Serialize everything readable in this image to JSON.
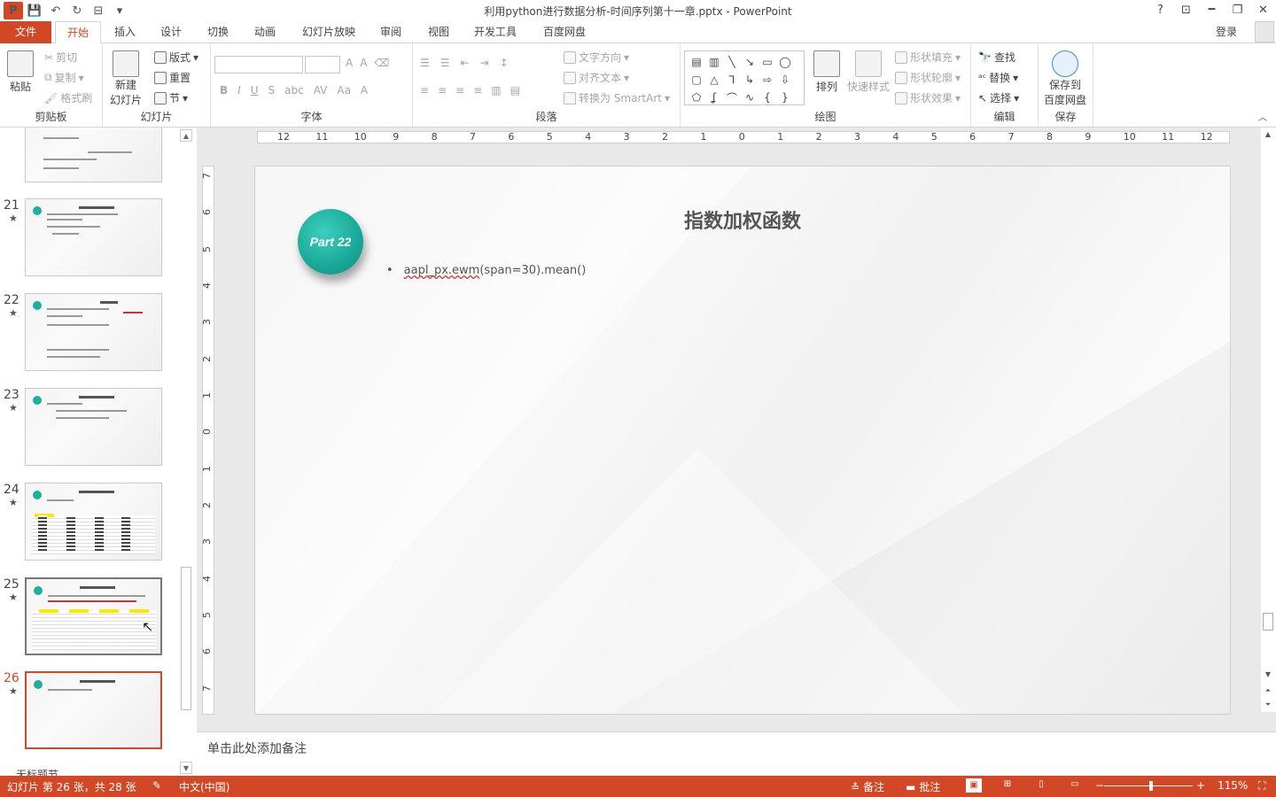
{
  "window": {
    "title": "利用python进行数据分析-时间序列第十一章.pptx - PowerPoint",
    "help": "?",
    "controls": [
      "⊡",
      "🗕",
      "❐",
      "✕"
    ]
  },
  "tabs": {
    "file": "文件",
    "items": [
      "开始",
      "插入",
      "设计",
      "切换",
      "动画",
      "幻灯片放映",
      "审阅",
      "视图",
      "开发工具",
      "百度网盘"
    ],
    "active": "开始",
    "login": "登录"
  },
  "ribbon": {
    "clipboard": {
      "label": "剪贴板",
      "paste": "粘贴",
      "cut": "剪切",
      "copy": "复制",
      "format_painter": "格式刷"
    },
    "slides": {
      "label": "幻灯片",
      "new_slide_1": "新建",
      "new_slide_2": "幻灯片",
      "layout": "版式",
      "reset": "重置",
      "section": "节"
    },
    "font": {
      "label": "字体"
    },
    "paragraph": {
      "label": "段落",
      "text_direction": "文字方向",
      "align_text": "对齐文本",
      "smartart": "转换为 SmartArt"
    },
    "drawing": {
      "label": "绘图",
      "arrange": "排列",
      "quick_styles": "快速样式",
      "shape_fill": "形状填充",
      "shape_outline": "形状轮廓",
      "shape_effects": "形状效果"
    },
    "editing": {
      "label": "编辑",
      "find": "查找",
      "replace": "替换",
      "select": "选择"
    },
    "save": {
      "label": "保存",
      "save_to_1": "保存到",
      "save_to_2": "百度网盘"
    }
  },
  "thumbnails": [
    {
      "num": "",
      "star": ""
    },
    {
      "num": "21",
      "star": "★"
    },
    {
      "num": "22",
      "star": "★"
    },
    {
      "num": "23",
      "star": "★"
    },
    {
      "num": "24",
      "star": "★"
    },
    {
      "num": "25",
      "star": "★"
    },
    {
      "num": "26",
      "star": "★"
    }
  ],
  "section_label": "无标题节",
  "ruler": {
    "h": [
      "12",
      "11",
      "10",
      "9",
      "8",
      "7",
      "6",
      "5",
      "4",
      "3",
      "2",
      "1",
      "0",
      "1",
      "2",
      "3",
      "4",
      "5",
      "6",
      "7",
      "8",
      "9",
      "10",
      "11",
      "12"
    ],
    "v": [
      "7",
      "6",
      "5",
      "4",
      "3",
      "2",
      "1",
      "0",
      "1",
      "2",
      "3",
      "4",
      "5",
      "6",
      "7"
    ]
  },
  "slide": {
    "badge": "Part 22",
    "title": "指数加权函数",
    "bullet_mark": "•",
    "bullet_code": "aapl_px.ewm",
    "bullet_rest": "(span=30).mean()"
  },
  "notes_placeholder": "单击此处添加备注",
  "status": {
    "slide_info": "幻灯片 第 26 张，共 28 张",
    "language": "中文(中国)",
    "notes": "备注",
    "comments": "批注",
    "zoom": "115%"
  }
}
